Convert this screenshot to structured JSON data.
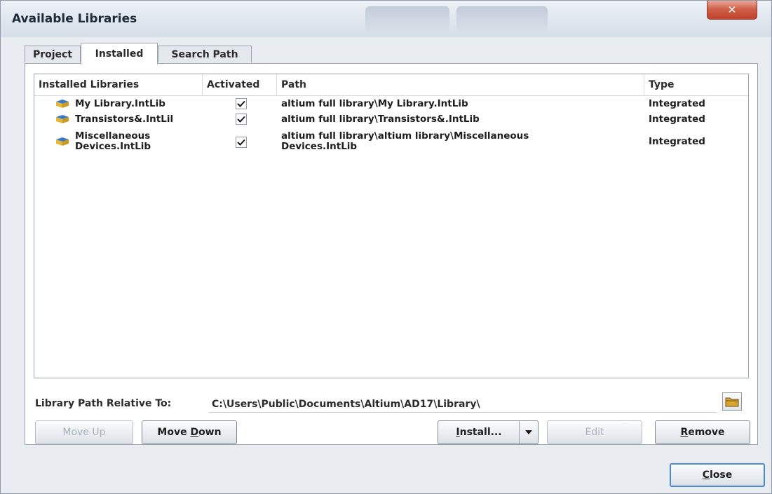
{
  "window": {
    "title": "Available Libraries",
    "close_glyph": "✕"
  },
  "tabs": [
    {
      "label": "Project",
      "active": false
    },
    {
      "label": "Installed",
      "active": true
    },
    {
      "label": "Search Path",
      "active": false
    }
  ],
  "table": {
    "columns": [
      "Installed Libraries",
      "Activated",
      "Path",
      "Type"
    ],
    "rows": [
      {
        "name": "My Library.IntLib",
        "activated": true,
        "path": "altium full library\\My Library.IntLib",
        "type": "Integrated"
      },
      {
        "name": "Transistors&.IntLil",
        "activated": true,
        "path": "altium full library\\Transistors&.IntLib",
        "type": "Integrated"
      },
      {
        "name": "Miscellaneous\nDevices.IntLib",
        "activated": true,
        "path": "altium full library\\altium library\\Miscellaneous\nDevices.IntLib",
        "type": "Integrated"
      }
    ]
  },
  "library_path": {
    "label": "Library Path Relative To:",
    "value": "C:\\Users\\Public\\Documents\\Altium\\AD17\\Library\\"
  },
  "buttons": {
    "move_up": {
      "label": "Move Up",
      "disabled": true
    },
    "move_down": {
      "label_pre": "Move ",
      "label_u": "D",
      "label_post": "own"
    },
    "install": {
      "label_pre": "",
      "label_u": "I",
      "label_post": "nstall..."
    },
    "edit": {
      "label": "Edit",
      "disabled": true
    },
    "remove": {
      "label_pre": "",
      "label_u": "R",
      "label_post": "emove"
    },
    "close": {
      "label_pre": "",
      "label_u": "C",
      "label_post": "lose"
    }
  },
  "colors": {
    "accent": "#4a8ad0",
    "icon_yellow": "#e6b63a",
    "icon_blue": "#3b78c4"
  },
  "icons": {
    "library": "library-book-icon",
    "folder": "folder-icon",
    "check": "checkmark-icon",
    "dropdown": "chevron-down-icon"
  }
}
